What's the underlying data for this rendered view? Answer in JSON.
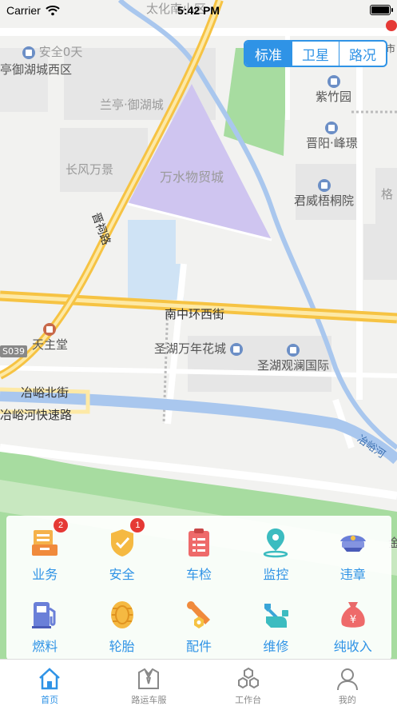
{
  "status_bar": {
    "carrier": "Carrier",
    "time": "5:42 PM"
  },
  "map": {
    "mode_tabs": [
      {
        "label": "标准",
        "active": true
      },
      {
        "label": "卫星",
        "active": false
      },
      {
        "label": "路况",
        "active": false
      }
    ],
    "labels": {
      "taihua": "太化南小区",
      "anquan": "安全0天",
      "yuhu_west": "亭御湖城西区",
      "shi": "市",
      "lanting": "兰亭·御湖城",
      "zhuyuan": "紫竹园",
      "jinyang": "晋阳·峰璟",
      "changfeng": "长风万景",
      "wanshui": "万水物贸城",
      "junwei": "君威梧桐院",
      "ge": "格",
      "jinci_road": "晋祠路",
      "nanzhong": "南中环西街",
      "tianzhutang": "天主堂",
      "s039": "S039",
      "shenghu_wannian": "圣湖万年花城",
      "shenghu_guanlan": "圣湖观澜国际",
      "yeyu_north": "冶峪北街",
      "yeyu_river_expressway": "冶峪河快速路",
      "yeyu_river": "冶峪河",
      "jin": "金"
    }
  },
  "functions": [
    {
      "label": "业务",
      "icon": "business-icon",
      "badge": "2"
    },
    {
      "label": "安全",
      "icon": "safety-shield-icon",
      "badge": "1"
    },
    {
      "label": "车检",
      "icon": "inspection-clipboard-icon",
      "badge": ""
    },
    {
      "label": "监控",
      "icon": "location-monitor-icon",
      "badge": ""
    },
    {
      "label": "违章",
      "icon": "police-cap-icon",
      "badge": ""
    },
    {
      "label": "燃料",
      "icon": "fuel-pump-icon",
      "badge": ""
    },
    {
      "label": "轮胎",
      "icon": "tire-icon",
      "badge": ""
    },
    {
      "label": "配件",
      "icon": "wrench-bolt-icon",
      "badge": ""
    },
    {
      "label": "维修",
      "icon": "repair-hand-icon",
      "badge": ""
    },
    {
      "label": "纯收入",
      "icon": "money-bag-icon",
      "badge": ""
    }
  ],
  "tabbar": [
    {
      "label": "首页",
      "icon": "home-icon",
      "active": true
    },
    {
      "label": "路运车服",
      "icon": "uniform-icon",
      "active": false
    },
    {
      "label": "工作台",
      "icon": "workbench-hexagon-icon",
      "active": false
    },
    {
      "label": "我的",
      "icon": "person-icon",
      "active": false
    }
  ],
  "colors": {
    "accent": "#2f93e6",
    "badge": "#e53935",
    "road_major": "#f6c343",
    "water": "#a9c7ee",
    "park": "#a7dca0",
    "mall": "#cfc5f0"
  }
}
